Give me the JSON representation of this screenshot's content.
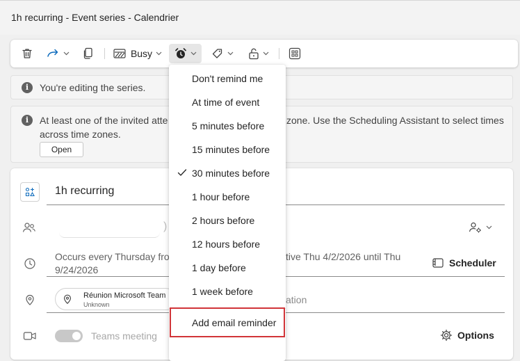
{
  "window": {
    "title": "1h recurring - Event series - Calendrier"
  },
  "toolbar": {
    "delete_icon": "trash-icon",
    "forward_icon": "forward-arrow-icon",
    "copy_icon": "copy-icon",
    "show_as_label": "Busy",
    "reminder_icon": "alarm-clock-icon",
    "categorize_icon": "tag-icon",
    "privacy_icon": "lock-open-icon",
    "apps_icon": "apps-grid-icon"
  },
  "banners": {
    "editing_series": "You're editing the series.",
    "timezone_line1_left": "At least one of the invited atte",
    "timezone_line1_right": "zone. Use the Scheduling Assistant to select times",
    "timezone_line2": "across time zones.",
    "open_button": "Open"
  },
  "event": {
    "title": "1h recurring",
    "occurs_left": "Occurs every Thursday fror",
    "occurs_right": "tive Thu 4/2/2026 until Thu",
    "occurs_line2": "9/24/2026",
    "scheduler_label": "Scheduler",
    "location_chip_name": "Réunion Microsoft Team",
    "location_chip_sub": "Unknown",
    "location_tail": "ation",
    "teams_label": "Teams meeting",
    "options_label": "Options"
  },
  "reminder_menu": {
    "items": [
      {
        "label": "Don't remind me",
        "checked": false
      },
      {
        "label": "At time of event",
        "checked": false
      },
      {
        "label": "5 minutes before",
        "checked": false
      },
      {
        "label": "15 minutes before",
        "checked": false
      },
      {
        "label": "30 minutes before",
        "checked": true
      },
      {
        "label": "1 hour before",
        "checked": false
      },
      {
        "label": "2 hours before",
        "checked": false
      },
      {
        "label": "12 hours before",
        "checked": false
      },
      {
        "label": "1 day before",
        "checked": false
      },
      {
        "label": "1 week before",
        "checked": false
      }
    ],
    "add_email_label": "Add email reminder",
    "highlight_color": "#d13438"
  },
  "colors": {
    "accent": "#0f6cbd",
    "highlight": "#d13438"
  }
}
